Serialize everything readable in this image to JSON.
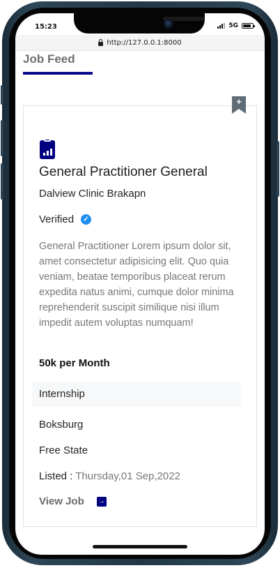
{
  "status_bar": {
    "time": "15:23",
    "network": "5G"
  },
  "browser": {
    "url": "http://127.0.0.1:8000"
  },
  "page": {
    "section_title": "Job Feed"
  },
  "job": {
    "bookmark_symbol": "+",
    "title": "General Practitioner General",
    "company": "Dalview Clinic Brakapn",
    "verified_label": "Verified",
    "description": "General Practitioner Lorem ipsum dolor sit, amet consectetur adipisicing elit. Quo quia veniam, beatae temporibus placeat rerum expedita natus animi, cumque dolor minima reprehenderit suscipit similique nisi illum impedit autem voluptas numquam!",
    "salary": "50k per Month",
    "type": "Internship",
    "city": "Boksburg",
    "province": "Free State",
    "listed_label": "Listed : ",
    "listed_date": "Thursday,01 Sep,2022",
    "view_label": "View Job"
  },
  "colors": {
    "accent": "#000080",
    "verified": "#1f8ef1",
    "bookmark": "#5f6b75"
  }
}
